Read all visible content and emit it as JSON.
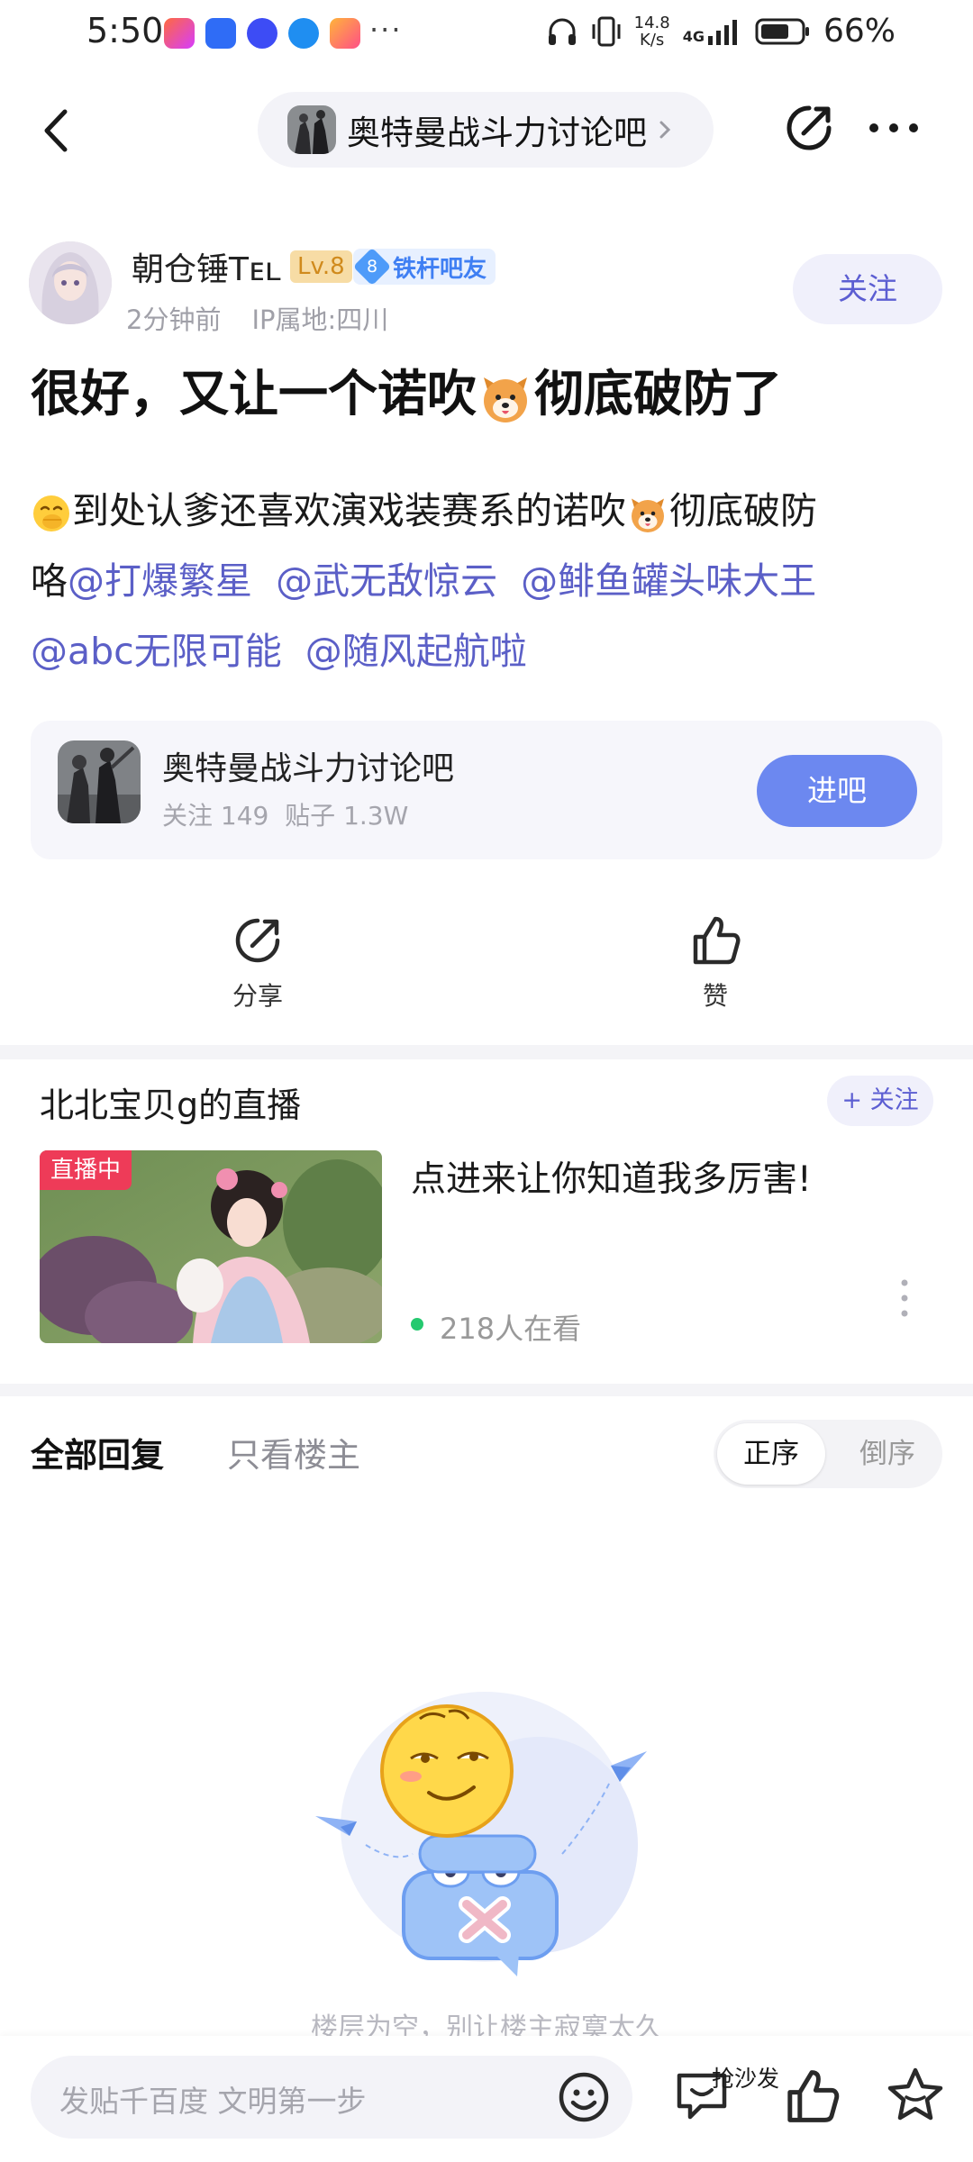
{
  "status_bar": {
    "time": "5:50",
    "more_dots": "···",
    "net_speed_value": "14.8",
    "net_speed_unit": "K/s",
    "network": "4G",
    "battery": "66%"
  },
  "nav": {
    "forum_name": "奥特曼战斗力讨论吧"
  },
  "author": {
    "name": "朝仓锤Tᴇʟ",
    "level": "Lv.8",
    "title_level": "8",
    "title": "铁杆吧友",
    "time": "2分钟前",
    "ip": "IP属地:四川",
    "follow_label": "关注"
  },
  "post": {
    "title_part1": "很好，又让一个诺吹",
    "title_part2": "彻底破防了",
    "body_line1_a": "到处认爹还喜欢演戏装赛系的诺吹",
    "body_line1_b": "彻底破防",
    "body_line2_prefix": "咯",
    "mentions": [
      "@打爆繁星",
      "@武无敌惊云",
      "@鲱鱼罐头味大王",
      "@abc无限可能",
      "@随风起航啦"
    ]
  },
  "forum_card": {
    "name": "奥特曼战斗力讨论吧",
    "follow_count": "关注 149",
    "post_count": "贴子 1.3W",
    "enter_label": "进吧"
  },
  "actions": {
    "share_label": "分享",
    "like_label": "赞"
  },
  "live": {
    "title": "北北宝贝g的直播",
    "follow_label": "+ 关注",
    "tag": "直播中",
    "caption": "点进来让你知道我多厉害!",
    "viewers": "218人在看"
  },
  "replies": {
    "tab_all": "全部回复",
    "tab_op": "只看楼主",
    "sort_asc": "正序",
    "sort_desc": "倒序",
    "empty_text": "楼层为空，别让楼主寂寞太久"
  },
  "bottom_bar": {
    "placeholder": "发贴千百度 文明第一步",
    "sofa_label": "抢沙发"
  },
  "colors": {
    "accent": "#5c5ed2",
    "enter_button": "#6c88f0",
    "live_tag": "#ee3b58",
    "online_dot": "#25c96f"
  },
  "icons": [
    "back-arrow-icon",
    "chevron-right-icon",
    "share-icon",
    "more-icon",
    "emoji-icon",
    "sofa-icon",
    "thumb-up-icon",
    "star-icon"
  ]
}
